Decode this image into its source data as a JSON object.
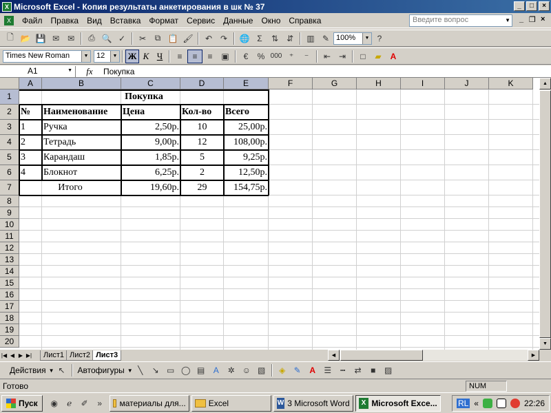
{
  "window": {
    "title": "Microsoft Excel - Копия результаты анкетирования в шк № 37",
    "doc_icon": "X"
  },
  "menu": {
    "items": [
      "Файл",
      "Правка",
      "Вид",
      "Вставка",
      "Формат",
      "Сервис",
      "Данные",
      "Окно",
      "Справка"
    ],
    "help_placeholder": "Введите вопрос"
  },
  "toolbar": {
    "zoom": "100%",
    "font_name": "Times New Roman",
    "font_size": "12",
    "bold": "Ж",
    "italic": "К",
    "underline": "Ч",
    "percent": "%",
    "thousands": "000"
  },
  "formula_bar": {
    "cell_ref": "A1",
    "fx": "fx",
    "content": "Покупка"
  },
  "sheet": {
    "columns": [
      "A",
      "B",
      "C",
      "D",
      "E",
      "F",
      "G",
      "H",
      "I",
      "J",
      "K"
    ],
    "rows": [
      "1",
      "2",
      "3",
      "4",
      "5",
      "6",
      "7",
      "8",
      "9",
      "10",
      "11",
      "12",
      "13",
      "14",
      "15",
      "16",
      "17",
      "18",
      "19",
      "20"
    ],
    "title": "Покупка",
    "headers": [
      "№",
      "Наименование",
      "Цена",
      "Кол-во",
      "Всего"
    ],
    "data": [
      [
        "1",
        "Ручка",
        "2,50р.",
        "10",
        "25,00р."
      ],
      [
        "2",
        "Тетрадь",
        "9,00р.",
        "12",
        "108,00р."
      ],
      [
        "3",
        "Карандаш",
        "1,85р.",
        "5",
        "9,25р."
      ],
      [
        "4",
        "Блокнот",
        "6,25р.",
        "2",
        "12,50р."
      ]
    ],
    "total": {
      "label": "Итого",
      "price": "19,60р.",
      "qty": "29",
      "sum": "154,75р."
    }
  },
  "tabs": [
    "Лист1",
    "Лист2",
    "Лист3"
  ],
  "drawing": {
    "actions": "Действия",
    "autoshapes": "Автофигуры"
  },
  "status": {
    "left": "Готово",
    "num": "NUM"
  },
  "taskbar": {
    "start": "Пуск",
    "buttons": [
      "материалы для...",
      "Excel",
      "3 Microsoft Word",
      "Microsoft Exce..."
    ],
    "lang": "RL",
    "clock": "22:26"
  }
}
